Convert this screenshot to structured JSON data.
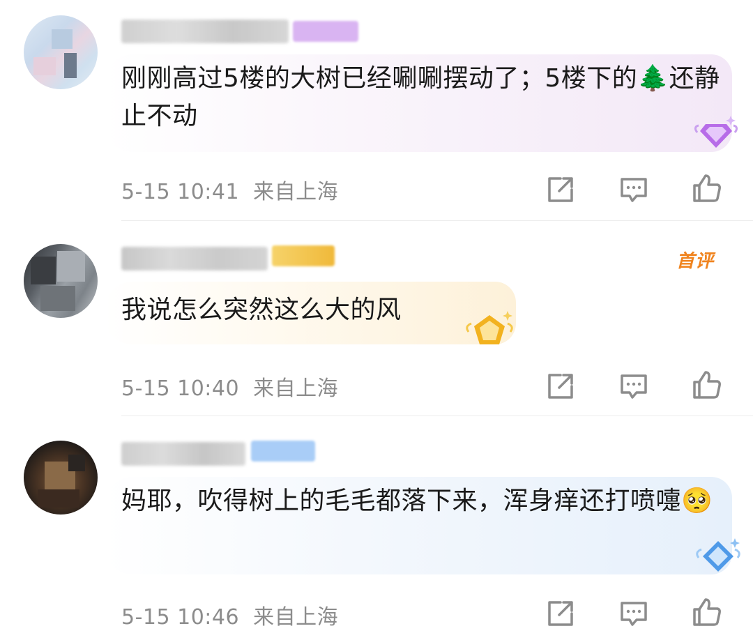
{
  "comments": [
    {
      "text": "刚刚高过5楼的大树已经唰唰摆动了；5楼下的🌲还静止不动",
      "time": "5-15 10:41",
      "location": "来自上海",
      "badge_color": "#d6a8f0",
      "gem": "purple-gem-icon"
    },
    {
      "text": "我说怎么突然这么大的风",
      "time": "5-15 10:40",
      "location": "来自上海",
      "badge_color": "#f3c64a",
      "first_tag": "首评",
      "gem": "gold-gem-icon"
    },
    {
      "text": "妈耶，吹得树上的毛毛都落下来，浑身痒还打喷嚏🥺",
      "time": "5-15 10:46",
      "location": "来自上海",
      "badge_color": "#9cc4f4",
      "gem": "blue-gem-icon"
    }
  ],
  "actions": {
    "share_icon": "share-icon",
    "reply_icon": "comment-icon",
    "like_icon": "thumbs-up-icon"
  }
}
